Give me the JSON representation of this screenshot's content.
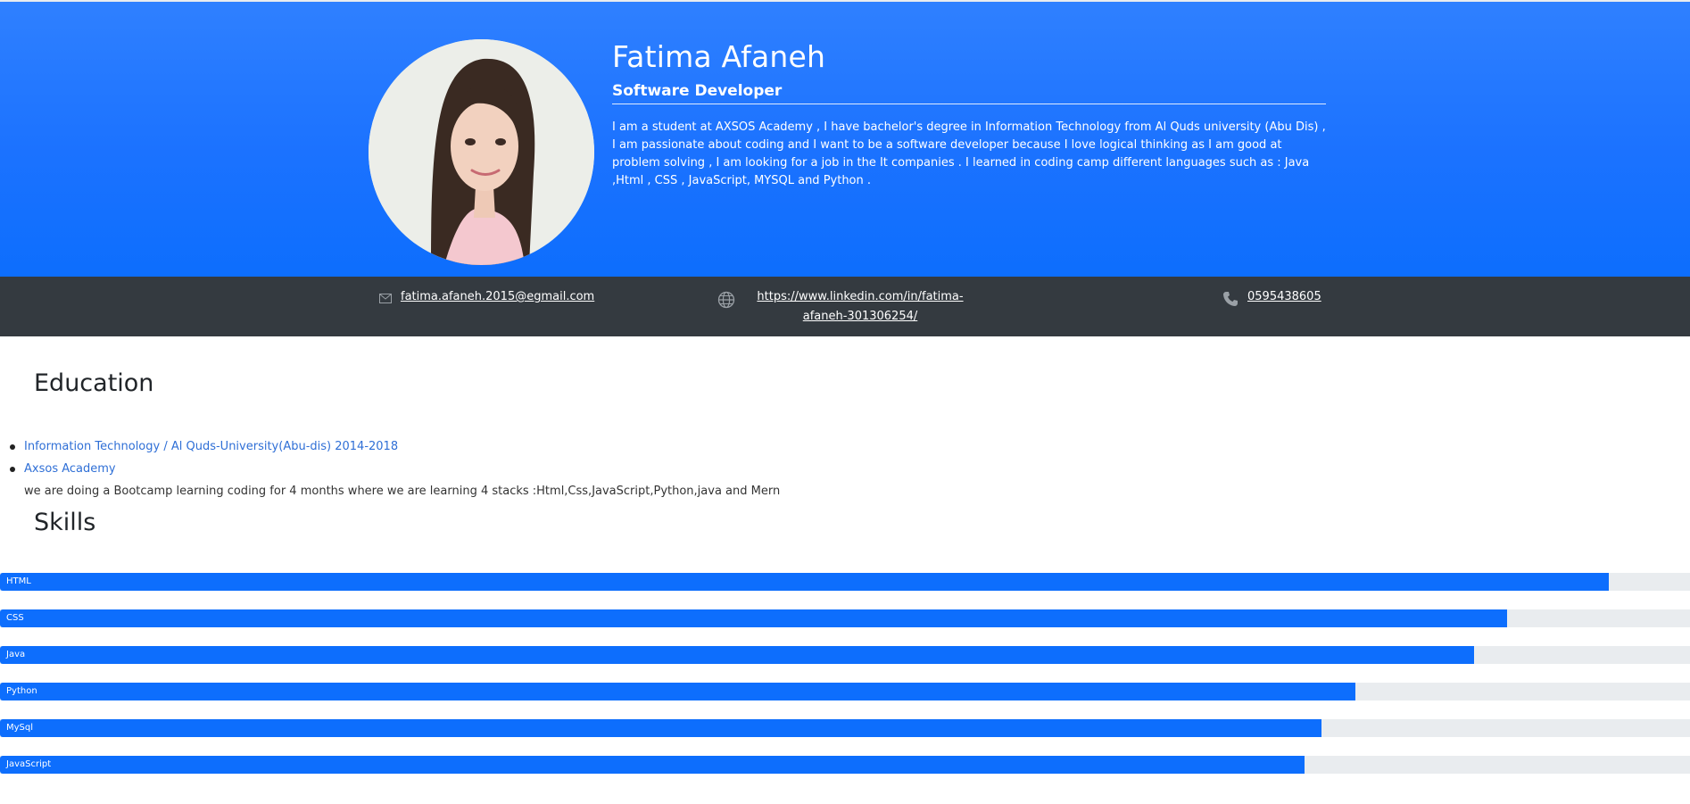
{
  "profile": {
    "name": "Fatima Afaneh",
    "title": "Software Developer",
    "bio": "I am a student at AXSOS Academy , I have bachelor's degree in Information Technology from Al Quds university (Abu Dis) , I am passionate about coding and I want to be a software developer because I love logical thinking as I am good at problem solving , I am looking for a job in the It companies . I learned in coding camp different languages such as : Java ,Html , CSS , JavaScript, MYSQL and Python ."
  },
  "contact": {
    "email": "fatima.afaneh.2015@egmail.com",
    "linkedin": "https://www.linkedin.com/in/fatima-afaneh-301306254/",
    "phone": "0595438605"
  },
  "education": {
    "heading": "Education",
    "items": [
      "Information Technology / Al Quds-University(Abu-dis) 2014-2018",
      "Axsos Academy"
    ],
    "note": "we are doing a Bootcamp learning coding for 4 months where we are learning 4 stacks :Html,Css,JavaScript,Python,java and Mern"
  },
  "skills": {
    "heading": "Skills",
    "items": [
      {
        "label": "HTML",
        "level": 0.952
      },
      {
        "label": "CSS",
        "level": 0.892
      },
      {
        "label": "Java",
        "level": 0.872
      },
      {
        "label": "Python",
        "level": 0.802
      },
      {
        "label": "MySql",
        "level": 0.782
      },
      {
        "label": "JavaScript",
        "level": 0.772
      }
    ]
  },
  "colors": {
    "accent": "#0d6efd",
    "contact_bar": "#343a40",
    "track": "#e9ecef",
    "link": "#2f6fd6"
  },
  "icons": [
    "profile-photo",
    "envelope-icon",
    "globe-icon",
    "phone-icon"
  ]
}
